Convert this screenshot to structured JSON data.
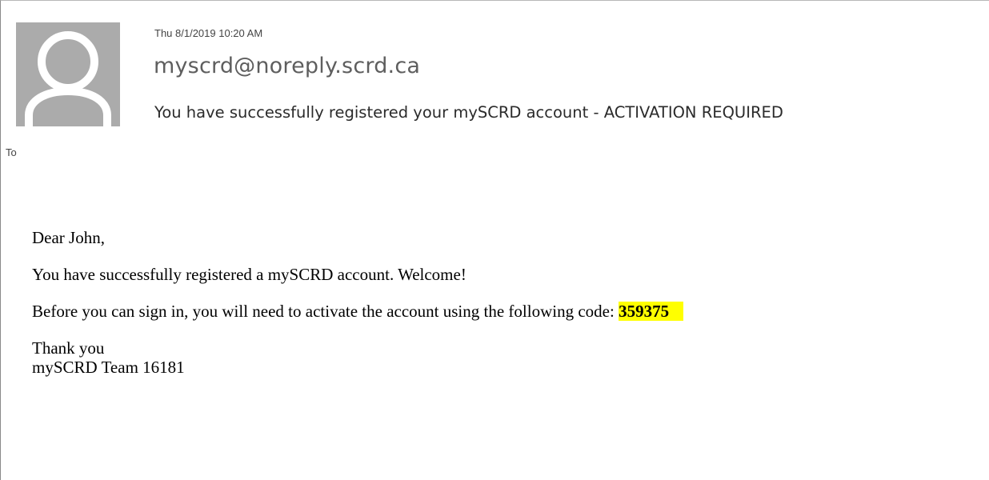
{
  "header": {
    "date": "Thu 8/1/2019 10:20 AM",
    "from": "myscrd@noreply.scrd.ca",
    "subject": "You have successfully registered your mySCRD account - ACTIVATION REQUIRED",
    "to_label": "To",
    "avatar_icon": "person-silhouette-icon"
  },
  "body": {
    "greeting": "Dear John,",
    "line1": "You have successfully registered a mySCRD account. Welcome!",
    "line2_prefix": "Before you can sign in, you will need to activate the account using the following code: ",
    "activation_code": "359375",
    "sign_off": "Thank you",
    "signature": "mySCRD Team 16181"
  },
  "colors": {
    "avatar_bg": "#ababab",
    "avatar_fg": "#ffffff",
    "highlight": "#ffff00"
  }
}
